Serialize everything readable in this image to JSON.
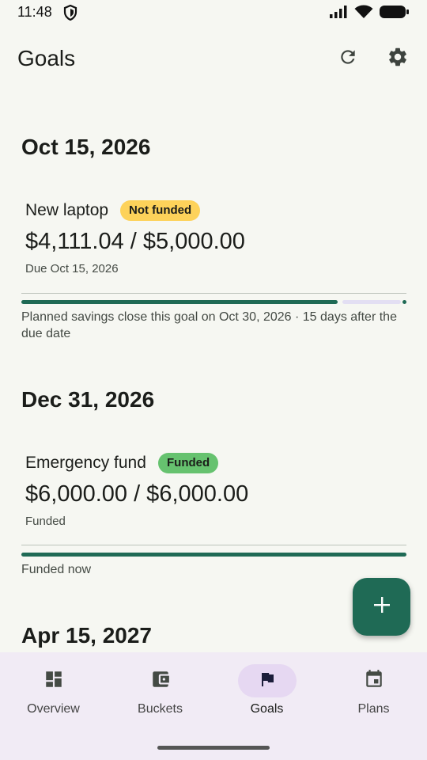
{
  "status": {
    "time": "11:48"
  },
  "app": {
    "title": "Goals"
  },
  "groups": [
    {
      "date": "Oct 15, 2026",
      "goal": {
        "name": "New laptop",
        "badge": "Not funded",
        "amount": "$4,111.04 / $5,000.00",
        "due": "Due Oct 15, 2026",
        "progress": 0.822,
        "note": "Planned savings close this goal on Oct 30, 2026 · 15 days after the due date"
      }
    },
    {
      "date": "Dec 31, 2026",
      "goal": {
        "name": "Emergency fund",
        "badge": "Funded",
        "amount": "$6,000.00 / $6,000.00",
        "due": "Funded",
        "progress": 1.0,
        "note": "Funded now"
      }
    },
    {
      "date": "Apr 15, 2027"
    }
  ],
  "nav": [
    {
      "label": "Overview",
      "icon": "dashboard-icon"
    },
    {
      "label": "Buckets",
      "icon": "wallet-icon"
    },
    {
      "label": "Goals",
      "icon": "flag-icon",
      "active": true
    },
    {
      "label": "Plans",
      "icon": "calendar-icon"
    }
  ],
  "colors": {
    "accent": "#1f6a55",
    "warn": "#fdd25a",
    "ok": "#66c26f",
    "nav_bg": "#f1ebf5"
  }
}
